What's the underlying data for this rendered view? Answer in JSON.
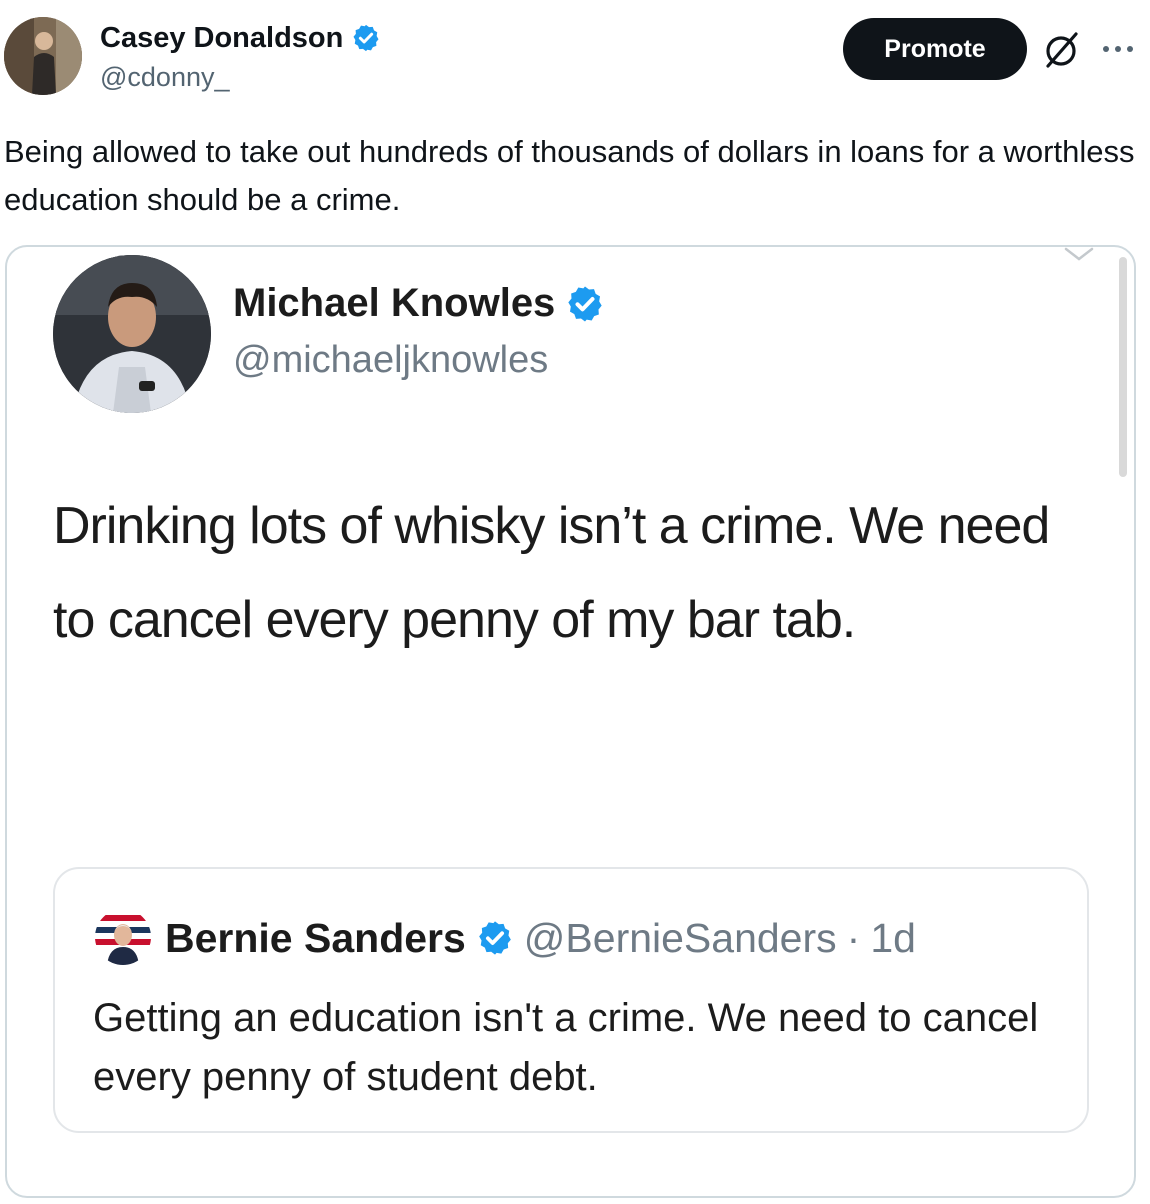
{
  "tweet": {
    "author_name": "Casey Donaldson",
    "author_handle": "@cdonny_",
    "promote_label": "Promote",
    "text": "Being allowed to take out hundreds of thousands of dollars in loans for a worthless education should be a crime."
  },
  "media": {
    "quoted_tweet": {
      "author_name": "Michael Knowles",
      "author_handle": "@michaeljknowles",
      "text": "Drinking lots of whisky isn’t a crime. We need to cancel every penny of my bar tab."
    },
    "nested_quote": {
      "author_name": "Bernie Sanders",
      "author_handle": "@BernieSanders",
      "separator": "·",
      "time": "1d",
      "text": "Getting an education isn't a crime. We need to cancel every penny of student debt."
    }
  },
  "colors": {
    "verified_blue": "#1d9bf0",
    "promote_bg": "#0f1419",
    "secondary_text": "#536471",
    "card_border": "#cfd9de"
  },
  "icons": [
    "verified-badge-icon",
    "grok-icon",
    "more-icon",
    "chevron-down-icon"
  ]
}
